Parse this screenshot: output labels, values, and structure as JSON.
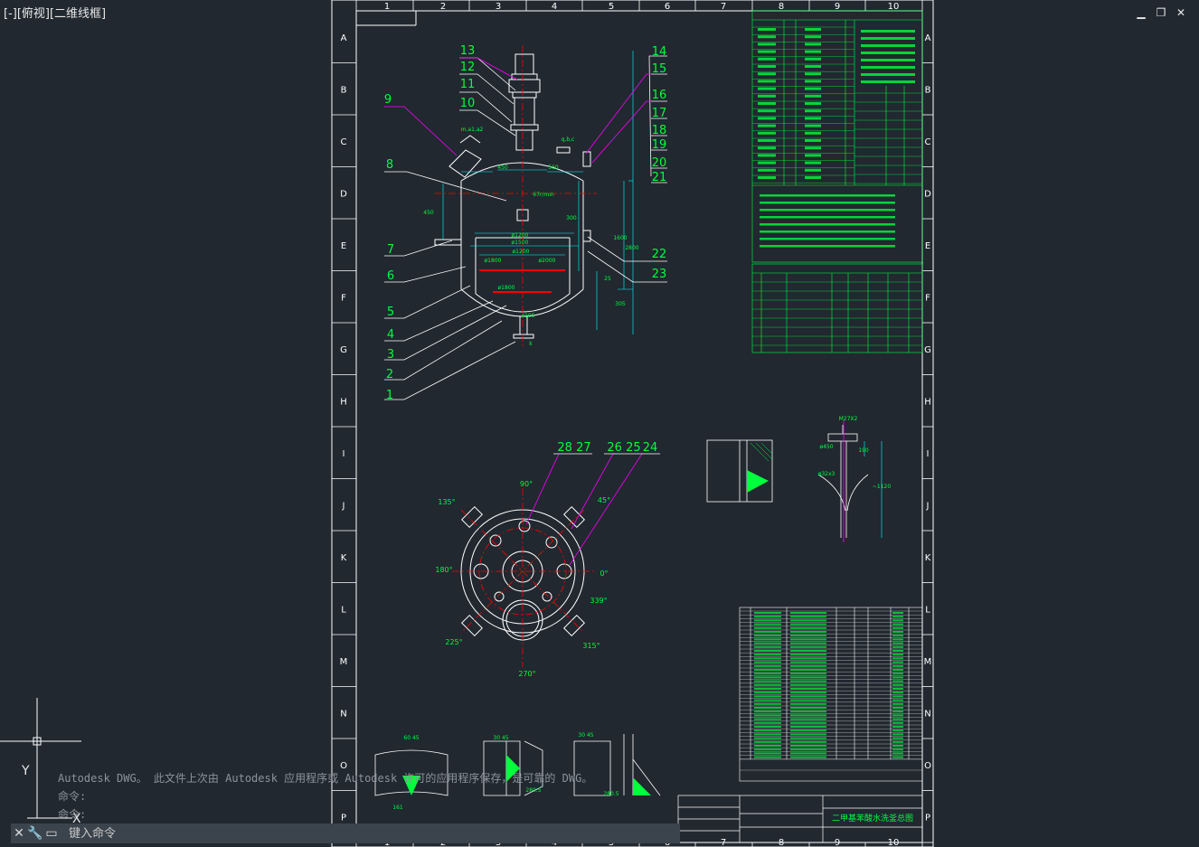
{
  "viewport": {
    "label": "[-][俯视][二维线框]"
  },
  "window_controls": {
    "minimize": "▁",
    "restore": "❐",
    "close": "✕"
  },
  "frame": {
    "columns": [
      "1",
      "2",
      "3",
      "4",
      "5",
      "6",
      "7",
      "8",
      "9",
      "10"
    ],
    "rows": [
      "A",
      "B",
      "C",
      "D",
      "E",
      "F",
      "G",
      "H",
      "I",
      "J",
      "K",
      "L",
      "M",
      "N",
      "O",
      "P"
    ]
  },
  "part_labels": [
    "13",
    "12",
    "11",
    "10",
    "9",
    "8",
    "7",
    "6",
    "5",
    "4",
    "3",
    "2",
    "1",
    "14",
    "15",
    "16",
    "17",
    "18",
    "19",
    "20",
    "21",
    "22",
    "23",
    "28 27",
    "26 25",
    "24"
  ],
  "dimensions": [
    "m,a1,a2",
    "q,b,c",
    "450",
    "560",
    "450",
    "67r/min",
    "300",
    "ø1200",
    "ø1500",
    "ø1200",
    "ø1800",
    "ø2000",
    "ø1800",
    "1600",
    "2800",
    "25",
    "305",
    "ø105",
    "k"
  ],
  "plan_angles": [
    "90°",
    "45°",
    "135°",
    "180°",
    "0°",
    "225°",
    "315°",
    "270°",
    "339°"
  ],
  "detail_labels": [
    "M27X2",
    "ø450",
    "ø32x3",
    "190",
    "~1120",
    "60 45",
    "161",
    "30 45",
    "280.5",
    "30 45",
    "280.5"
  ],
  "title_block": {
    "title": "二甲基苯酸水洗釜总图"
  },
  "command": {
    "history": [
      "Autodesk DWG。  此文件上次由 Autodesk 应用程序或 Autodesk 许可的应用程序保存，是可靠的 DWG。",
      "命令:",
      "命令:"
    ],
    "placeholder": "键入命令"
  },
  "ucs": {
    "x": "X",
    "y": "Y"
  },
  "colors": {
    "background": "#212830",
    "linework": "#ffffff",
    "annotation": "#00ff3c",
    "leader": "#ff00ff",
    "center": "#ff0000",
    "hidden": "#00ffff"
  }
}
